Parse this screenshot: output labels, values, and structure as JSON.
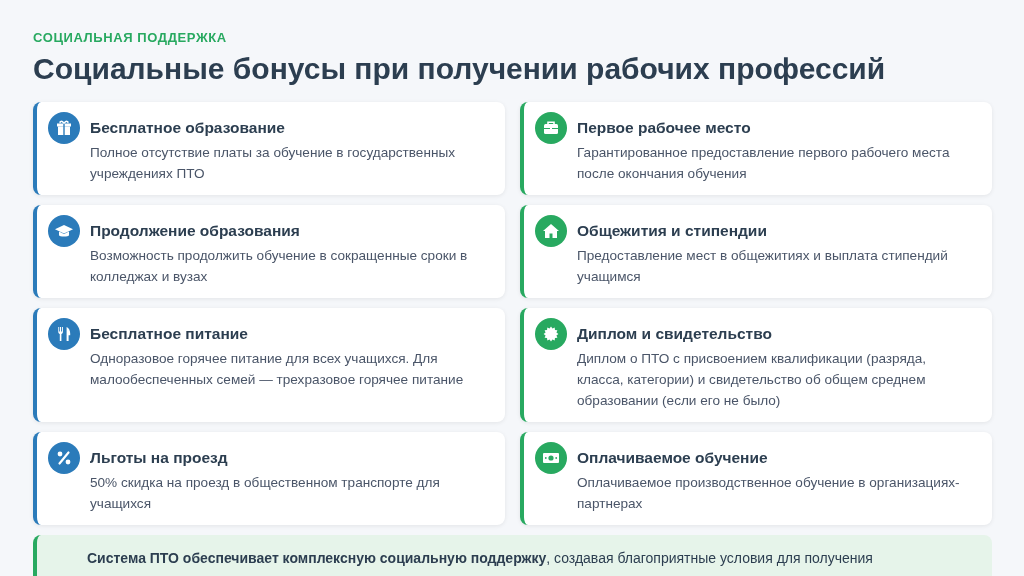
{
  "header": {
    "eyebrow": "СОЦИАЛЬНАЯ ПОДДЕРЖКА",
    "title": "Социальные бонусы при получении рабочих профессий"
  },
  "cards": [
    {
      "title": "Бесплатное образование",
      "description": "Полное отсутствие платы за обучение в государственных учреждениях ПТО",
      "color": "#2b7bba"
    },
    {
      "title": "Первое рабочее место",
      "description": "Гарантированное предоставление первого рабочего места после окончания обучения",
      "color": "#28a960"
    },
    {
      "title": "Продолжение образования",
      "description": "Возможность продолжить обучение в сокращенные сроки в колледжах и вузах",
      "color": "#2b7bba"
    },
    {
      "title": "Общежития и стипендии",
      "description": "Предоставление мест в общежитиях и выплата стипендий учащимся",
      "color": "#28a960"
    },
    {
      "title": "Бесплатное питание",
      "description": "Одноразовое горячее питание для всех учащихся. Для малообеспеченных семей — трехразовое горячее питание",
      "color": "#2b7bba"
    },
    {
      "title": "Диплом и свидетельство",
      "description": "Диплом о ПТО с присвоением квалификации (разряда, класса, категории) и свидетельство об общем среднем образовании (если его не было)",
      "color": "#28a960"
    },
    {
      "title": "Льготы на проезд",
      "description": "50% скидка на проезд в общественном транспорте для учащихся",
      "color": "#2b7bba"
    },
    {
      "title": "Оплачиваемое обучение",
      "description": "Оплачиваемое производственное обучение в организациях-партнерах",
      "color": "#28a960"
    }
  ],
  "summary": {
    "text": "**Система ПТО обеспечивает комплексную социальную поддержку**, создавая благоприятные условия для получения"
  }
}
